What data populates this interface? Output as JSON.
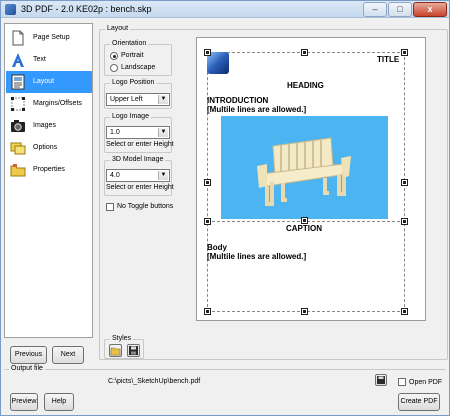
{
  "window": {
    "title": "3D PDF - 2.0 KE02p : bench.skp",
    "minimize_glyph": "–",
    "maximize_glyph": "□",
    "close_glyph": "x"
  },
  "nav": {
    "items": [
      {
        "label": "Page Setup",
        "icon": "page-icon",
        "selected": false
      },
      {
        "label": "Text",
        "icon": "text-icon",
        "selected": false
      },
      {
        "label": "Layout",
        "icon": "layout-icon",
        "selected": true
      },
      {
        "label": "Margins/Offsets",
        "icon": "margins-icon",
        "selected": false
      },
      {
        "label": "Images",
        "icon": "camera-icon",
        "selected": false
      },
      {
        "label": "Options",
        "icon": "options-icon",
        "selected": false
      },
      {
        "label": "Properties",
        "icon": "properties-icon",
        "selected": false
      }
    ],
    "previous_label": "Previous",
    "next_label": "Next"
  },
  "layout_panel": {
    "group_label": "Layout",
    "orientation": {
      "label": "Orientation",
      "options": [
        "Portrait",
        "Landscape"
      ],
      "selected": "Portrait"
    },
    "logo_position": {
      "label": "Logo Position",
      "value": "Upper Left"
    },
    "logo_image": {
      "label": "Logo Image",
      "value": "1.0",
      "hint": "Select or enter Height"
    },
    "model_image": {
      "label": "3D Model Image",
      "value": "4.0",
      "hint": "Select or enter Height"
    },
    "no_toggle": {
      "label": "No Toggle buttons",
      "checked": false
    },
    "styles_label": "Styles"
  },
  "preview": {
    "title": "TITLE",
    "heading": "HEADING",
    "intro_line1": "INTRODUCTION",
    "intro_line2": "[Multile lines are allowed.]",
    "caption": "CAPTION",
    "body_line1": "Body",
    "body_line2": "[Multile lines are allowed.]",
    "model_bg_color": "#4db4f2"
  },
  "output": {
    "label": "Output file",
    "path": "C:\\picts\\_SketchUp\\bench.pdf",
    "open_pdf_label": "Open PDF",
    "open_pdf_checked": false
  },
  "footer": {
    "preview_label": "Preview",
    "help_label": "Help",
    "create_label": "Create PDF"
  }
}
